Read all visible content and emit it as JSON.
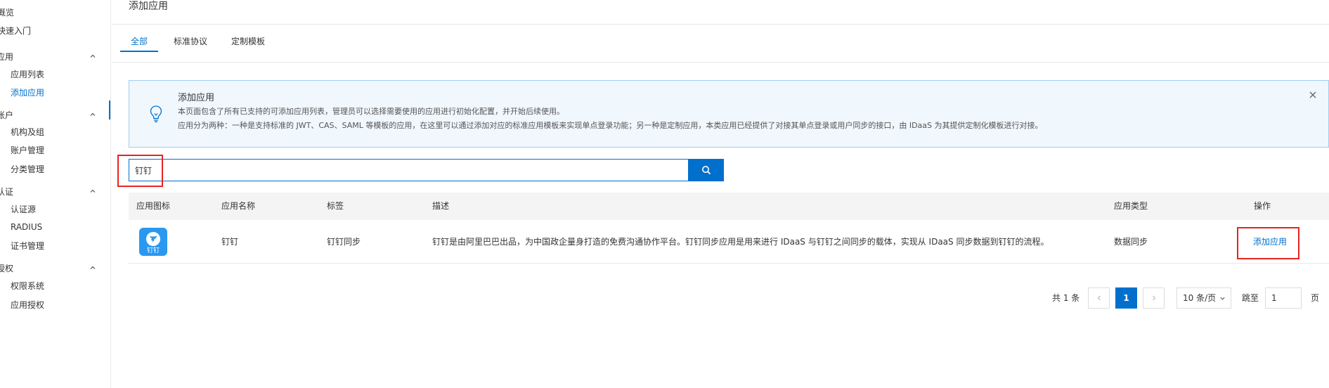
{
  "sidebar": {
    "items": [
      {
        "label": "概览",
        "type": "top"
      },
      {
        "label": "快速入门",
        "type": "top"
      },
      {
        "label": "应用",
        "type": "group"
      },
      {
        "label": "应用列表",
        "type": "sub"
      },
      {
        "label": "添加应用",
        "type": "sub",
        "active": true
      },
      {
        "label": "账户",
        "type": "group"
      },
      {
        "label": "机构及组",
        "type": "sub"
      },
      {
        "label": "账户管理",
        "type": "sub"
      },
      {
        "label": "分类管理",
        "type": "sub"
      },
      {
        "label": "认证",
        "type": "group"
      },
      {
        "label": "认证源",
        "type": "sub"
      },
      {
        "label": "RADIUS",
        "type": "sub"
      },
      {
        "label": "证书管理",
        "type": "sub"
      },
      {
        "label": "授权",
        "type": "group"
      },
      {
        "label": "权限系统",
        "type": "sub"
      },
      {
        "label": "应用授权",
        "type": "sub"
      }
    ]
  },
  "header": {
    "title": "添加应用"
  },
  "tabs": [
    {
      "label": "全部",
      "active": true
    },
    {
      "label": "标准协议",
      "active": false
    },
    {
      "label": "定制模板",
      "active": false
    }
  ],
  "alert": {
    "icon": "lightbulb-icon",
    "title": "添加应用",
    "line1": "本页面包含了所有已支持的可添加应用列表，管理员可以选择需要使用的应用进行初始化配置，并开始后续使用。",
    "line2": "应用分为两种：一种是支持标准的 JWT、CAS、SAML 等模板的应用，在这里可以通过添加对应的标准应用模板来实现单点登录功能；另一种是定制应用，本类应用已经提供了对接其单点登录或用户同步的接口，由 IDaaS 为其提供定制化模板进行对接。"
  },
  "search": {
    "value": "钉钉",
    "button_icon": "search-icon"
  },
  "table": {
    "columns": [
      "应用图标",
      "应用名称",
      "标签",
      "描述",
      "应用类型",
      "操作"
    ],
    "rows": [
      {
        "icon_text": "钉钉",
        "name": "钉钉",
        "tag": "钉钉同步",
        "description": "钉钉是由阿里巴巴出品，为中国政企量身打造的免费沟通协作平台。钉钉同步应用是用来进行 IDaaS 与钉钉之间同步的载体，实现从 IDaaS 同步数据到钉钉的流程。",
        "type": "数据同步",
        "action": "添加应用"
      }
    ]
  },
  "pagination": {
    "total_text": "共 1 条",
    "current_page": "1",
    "page_size": "10 条/页",
    "jump_label": "跳至",
    "jump_value": "1",
    "page_suffix": "页"
  },
  "colors": {
    "accent": "#0070cc",
    "alert_bg": "#f0f7fd",
    "alert_border": "#9fcdf1",
    "highlight": "#e8231d",
    "app_logo": "#2a98f0"
  }
}
